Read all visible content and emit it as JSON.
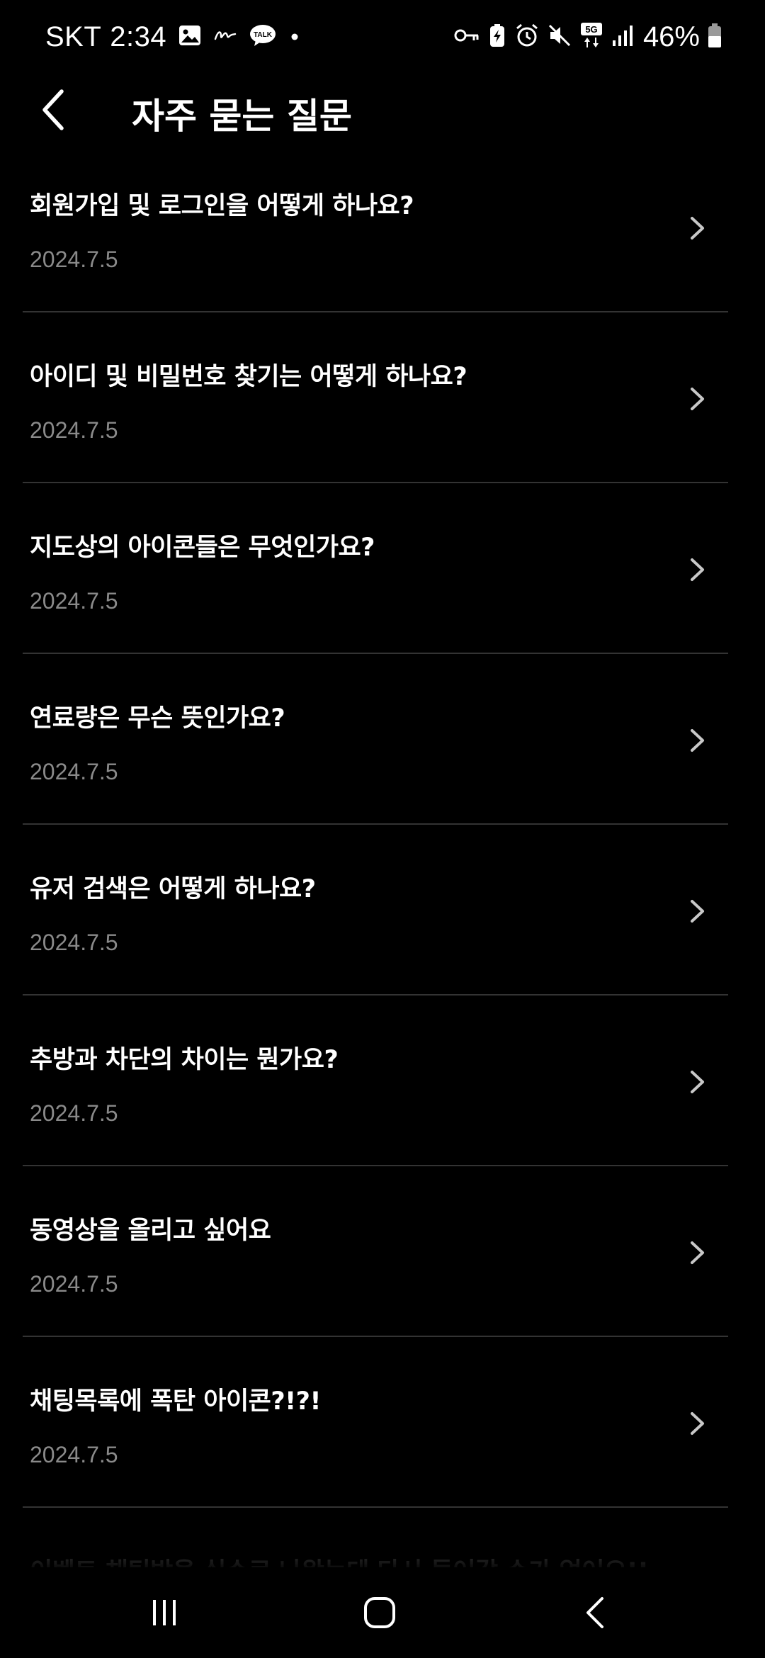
{
  "status_bar": {
    "carrier": "SKT",
    "time": "2:34",
    "battery_percent": "46%",
    "icons_left": [
      "gallery-icon",
      "handwriting-icon",
      "kakaotalk-icon",
      "dot-icon"
    ],
    "icons_right": [
      "key-icon",
      "battery-saver-icon",
      "alarm-icon",
      "mute-icon",
      "5g-icon",
      "signal-icon",
      "battery-icon"
    ],
    "talk_badge": "TALK",
    "network_badge": "5G"
  },
  "header": {
    "title": "자주 묻는 질문",
    "back_icon": "chevron-left-icon"
  },
  "faq": {
    "items": [
      {
        "question": "회원가입 및 로그인을 어떻게 하나요?",
        "date": "2024.7.5"
      },
      {
        "question": "아이디 및 비밀번호 찾기는 어떻게 하나요?",
        "date": "2024.7.5"
      },
      {
        "question": "지도상의 아이콘들은 무엇인가요?",
        "date": "2024.7.5"
      },
      {
        "question": "연료량은 무슨 뜻인가요?",
        "date": "2024.7.5"
      },
      {
        "question": "유저 검색은 어떻게 하나요?",
        "date": "2024.7.5"
      },
      {
        "question": "추방과 차단의 차이는 뭔가요?",
        "date": "2024.7.5"
      },
      {
        "question": "동영상을 올리고 싶어요",
        "date": "2024.7.5"
      },
      {
        "question": "채팅목록에 폭탄 아이콘?!?!",
        "date": "2024.7.5"
      },
      {
        "question": "이벤트 채팅방을 실수로 나왔는데 다시 들어갈 수가 없어요!!",
        "date": ""
      }
    ],
    "chevron_icon": "chevron-right-icon"
  },
  "nav_bar": {
    "buttons": [
      "recents-icon",
      "home-icon",
      "back-icon"
    ]
  },
  "colors": {
    "background": "#000000",
    "text_primary": "#ffffff",
    "text_secondary": "#8a8a8a",
    "divider": "#333333"
  }
}
